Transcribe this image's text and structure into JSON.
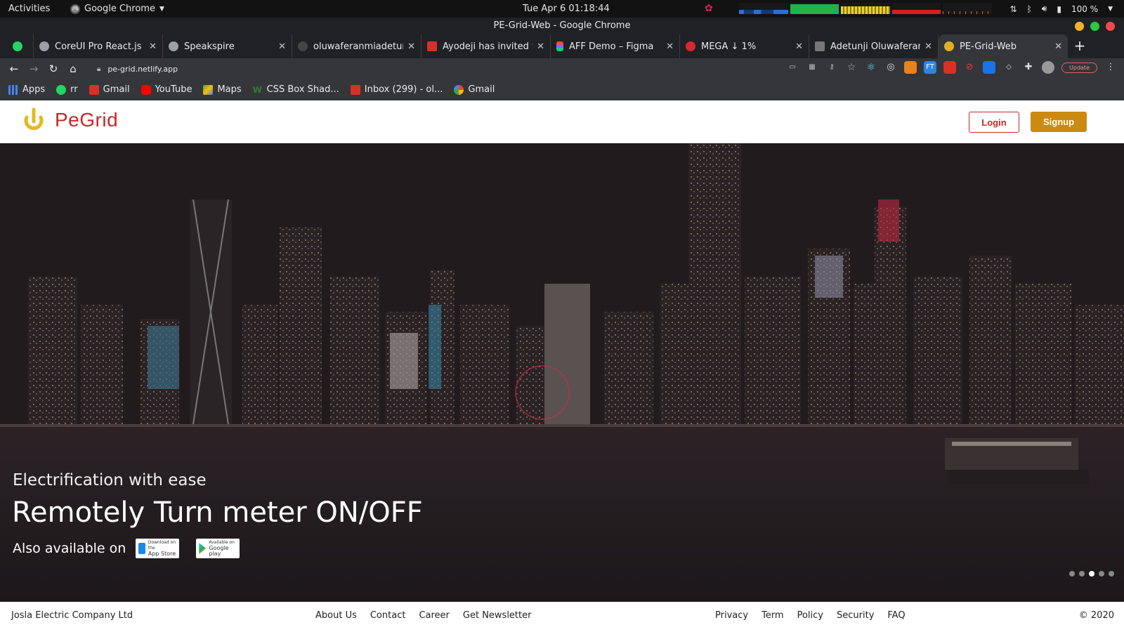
{
  "system_bar": {
    "activities": "Activities",
    "app_name": "Google Chrome",
    "datetime": "Tue Apr 6  01:18:44",
    "battery": "100 %"
  },
  "window": {
    "title": "PE-Grid-Web - Google Chrome"
  },
  "tabs": [
    {
      "label": "CoreUI Pro React.js",
      "favicon_color": "#9aa0a6"
    },
    {
      "label": "Speakspire",
      "favicon_color": "#9aa0a6"
    },
    {
      "label": "oluwaferanmiadetunji",
      "favicon_color": "#444444"
    },
    {
      "label": "Ayodeji has invited you",
      "favicon_color": "#d93025"
    },
    {
      "label": "AFF Demo – Figma",
      "favicon_color": "#f24e1e"
    },
    {
      "label": "MEGA ↓ 1%",
      "favicon_color": "#d9272e"
    },
    {
      "label": "Adetunji Oluwaferanmi",
      "favicon_color": "#777777"
    },
    {
      "label": "PE-Grid-Web",
      "favicon_color": "#e0b020"
    }
  ],
  "address_bar": {
    "url": "pe-grid.netlify.app",
    "update_label": "Update"
  },
  "bookmarks": [
    {
      "label": "Apps",
      "color": "#4285f4"
    },
    {
      "label": "rr",
      "color": "#25d366"
    },
    {
      "label": "Gmail",
      "color": "#d93025"
    },
    {
      "label": "YouTube",
      "color": "#ff0000"
    },
    {
      "label": "Maps",
      "color": "#34a853"
    },
    {
      "label": "CSS Box Shad...",
      "color": "#2e7d32"
    },
    {
      "label": "Inbox (299) - ol...",
      "color": "#d93025"
    },
    {
      "label": "Gmail",
      "color": "#4285f4"
    }
  ],
  "site": {
    "brand": "PeGrid",
    "login_label": "Login",
    "signup_label": "Signup",
    "brand_color": "#c62828",
    "accent_color": "#cc8a10"
  },
  "hero": {
    "subtitle": "Electrification with ease",
    "title": "Remotely Turn meter ON/OFF",
    "available_label": "Also available on",
    "app_store": {
      "small": "Download on the",
      "big": "App Store"
    },
    "google_play": {
      "small": "Available on",
      "big": "Google play"
    },
    "slides_total": 5,
    "active_slide": 3
  },
  "footer": {
    "company": "Josla Electric Company Ltd",
    "links_left": [
      "About Us",
      "Contact",
      "Career",
      "Get Newsletter"
    ],
    "links_right": [
      "Privacy",
      "Term",
      "Policy",
      "Security",
      "FAQ"
    ],
    "copyright": "© 2020"
  }
}
